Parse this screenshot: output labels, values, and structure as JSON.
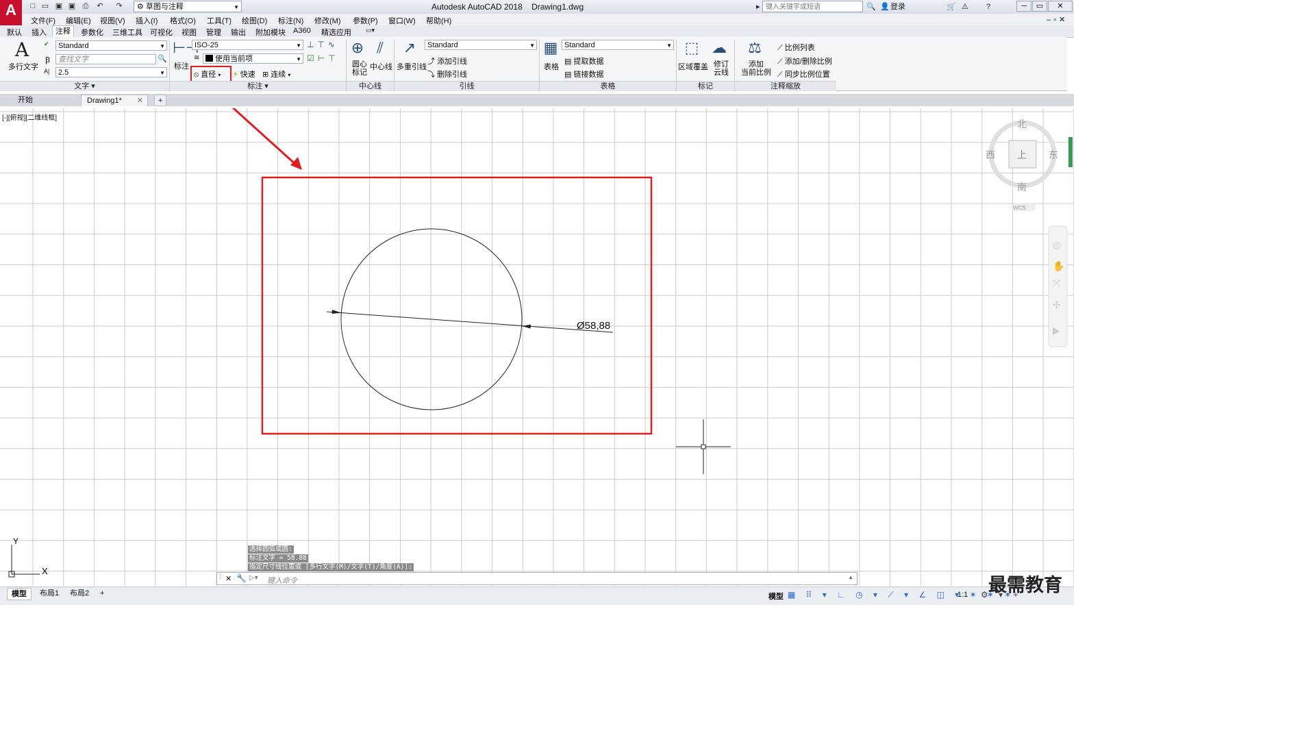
{
  "app": {
    "logo": "A",
    "title": "Autodesk AutoCAD 2018    Drawing1.dwg",
    "workspace": "草图与注释",
    "search_placeholder": "键入关键字或短语",
    "login": "登录"
  },
  "menu": [
    "文件(F)",
    "编辑(E)",
    "视图(V)",
    "插入(I)",
    "格式(O)",
    "工具(T)",
    "绘图(D)",
    "标注(N)",
    "修改(M)",
    "参数(P)",
    "窗口(W)",
    "帮助(H)"
  ],
  "ribbon_tabs": [
    "默认",
    "插入",
    "注释",
    "参数化",
    "三维工具",
    "可视化",
    "视图",
    "管理",
    "输出",
    "附加模块",
    "A360",
    "精选应用"
  ],
  "active_tab": "注释",
  "ribbon": {
    "text": {
      "multiline": "多行文字",
      "style": "Standard",
      "find_placeholder": "查找文字",
      "height": "2.5",
      "panel": "文字"
    },
    "dim": {
      "label": "标注",
      "style": "ISO-25",
      "layer": "使用当前项",
      "diameter": "直径",
      "quick": "快速",
      "continue": "连续",
      "panel": "标注"
    },
    "centerline": {
      "center_mark": "圆心\n标记",
      "center_line": "中心线",
      "panel": "中心线"
    },
    "leader": {
      "multileader": "多重引线",
      "style": "Standard",
      "add": "添加引线",
      "remove": "删除引线",
      "panel": "引线"
    },
    "table": {
      "table": "表格",
      "style": "Standard",
      "extract": "提取数据",
      "link": "链接数据",
      "panel": "表格"
    },
    "markup": {
      "wipeout": "区域覆盖",
      "revcloud": "修订\n云线",
      "panel": "标记"
    },
    "scale": {
      "add_current": "添加\n当前比例",
      "scale_list": "比例列表",
      "add_delete": "添加/删除比例",
      "sync": "同步比例位置",
      "panel": "注释缩放"
    }
  },
  "doc_tabs": [
    "开始",
    "Drawing1*"
  ],
  "view_label": "[-][俯视][二维线框]",
  "viewcube": {
    "n": "北",
    "s": "南",
    "e": "东",
    "w": "西",
    "top": "上",
    "wcs": "WCS"
  },
  "ucs": {
    "x": "X",
    "y": "Y"
  },
  "dimension_text": "Ø58,88",
  "command_history": [
    "选择圆弧或圆:",
    "标注文字 = 58.88",
    "指定尺寸线位置或 [多行文字(M)/文字(T)/角度(A)]:"
  ],
  "command_placeholder": "键入命令",
  "layout_tabs": [
    "模型",
    "布局1",
    "布局2"
  ],
  "status": {
    "model": "模型",
    "scale": "1:1"
  },
  "watermark": "最需教育",
  "colors": {
    "highlight": "#e31b1b",
    "grid": "#c9c9c9",
    "accent": "#c8102e"
  }
}
